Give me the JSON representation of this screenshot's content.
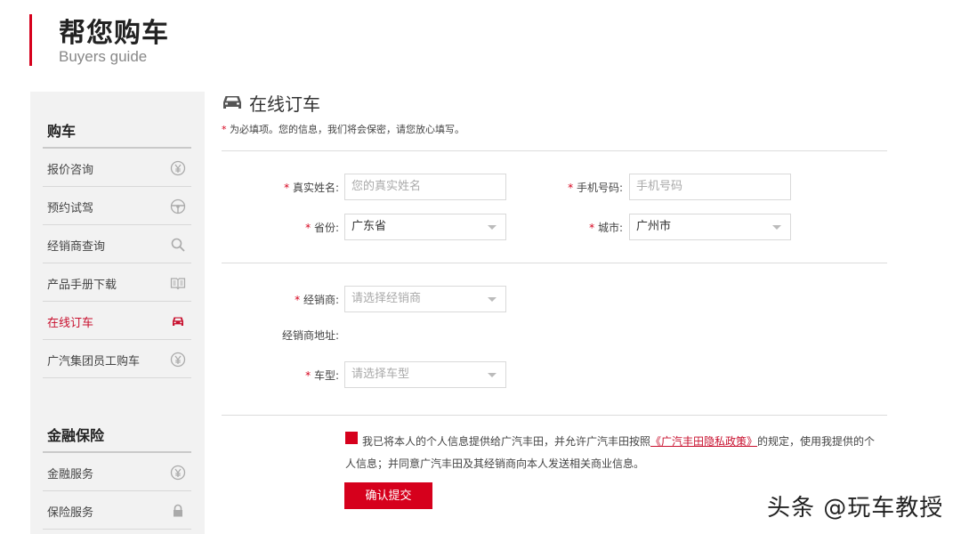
{
  "header": {
    "title": "帮您购车",
    "subtitle": "Buyers guide"
  },
  "sidebar": {
    "sections": [
      {
        "title": "购车",
        "items": [
          {
            "label": "报价咨询",
            "icon": "yen-circle-icon",
            "active": false
          },
          {
            "label": "预约试驾",
            "icon": "steering-wheel-icon",
            "active": false
          },
          {
            "label": "经销商查询",
            "icon": "search-icon",
            "active": false
          },
          {
            "label": "产品手册下载",
            "icon": "open-book-icon",
            "active": false
          },
          {
            "label": "在线订车",
            "icon": "car-icon",
            "active": true
          },
          {
            "label": "广汽集团员工购车",
            "icon": "yen-circle-icon",
            "active": false
          }
        ]
      },
      {
        "title": "金融保险",
        "items": [
          {
            "label": "金融服务",
            "icon": "yen-circle-icon",
            "active": false
          },
          {
            "label": "保险服务",
            "icon": "lock-icon",
            "active": false
          }
        ]
      }
    ]
  },
  "main": {
    "title": "在线订车",
    "required_star": "*",
    "required_note": "为必填项。您的信息，我们将会保密，请您放心填写。",
    "form": {
      "name": {
        "label": "真实姓名:",
        "placeholder": "您的真实姓名"
      },
      "phone": {
        "label": "手机号码:",
        "placeholder": "手机号码"
      },
      "province": {
        "label": "省份:",
        "value": "广东省"
      },
      "city": {
        "label": "城市:",
        "value": "广州市"
      },
      "dealer": {
        "label": "经销商:",
        "placeholder": "请选择经销商"
      },
      "dealer_address": {
        "label": "经销商地址:"
      },
      "model": {
        "label": "车型:",
        "placeholder": "请选择车型"
      }
    },
    "agreement": {
      "text_before": "我已将本人的个人信息提供给广汽丰田，并允许广汽丰田按照",
      "policy_link": "《广汽丰田隐私政策》",
      "text_after": "的规定，使用我提供的个人信息；并同意广汽丰田及其经销商向本人发送相关商业信息。"
    },
    "submit_label": "确认提交"
  },
  "watermark": "头条 @玩车教授",
  "colors": {
    "accent": "#d6001c",
    "sidebar_bg": "#f2f2f2"
  }
}
